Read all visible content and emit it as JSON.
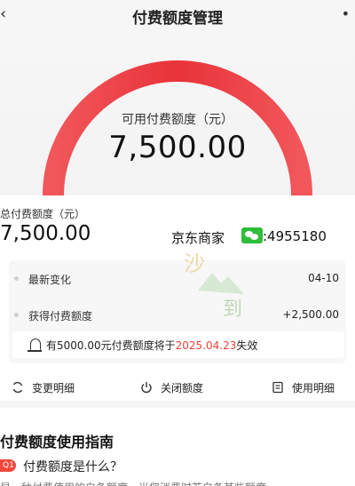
{
  "header": {
    "title": "付费额度管理",
    "back_icon": "chevron-left-icon",
    "more_icon": "more-icon"
  },
  "hero": {
    "available_label": "可用付费额度（元）",
    "available_amount": "7,500.00",
    "gauge_fill_fraction": 1.0,
    "gauge_color": "#f0473c"
  },
  "summary": {
    "total_label": "总付费额度（元）",
    "total_amount": "7,500.00",
    "watermark_text": "京东商家",
    "watermark_icon": "wechat-icon",
    "watermark_id": ":4955180"
  },
  "details": [
    {
      "label": "最新变化",
      "value": "04-10"
    },
    {
      "label": "获得付费额度",
      "value": "+2,500.00"
    }
  ],
  "notice": {
    "prefix": "有5000.00元付费额度将于",
    "date": "2025.04.23",
    "suffix": "失效",
    "icon": "bell-icon"
  },
  "actions": [
    {
      "label": "变更明细",
      "icon": "refresh-icon"
    },
    {
      "label": "关闭额度",
      "icon": "power-icon"
    },
    {
      "label": "使用明细",
      "icon": "document-icon"
    }
  ],
  "guide": {
    "title": "付费额度使用指南",
    "q_badge": "Q1",
    "question": "付费额度是什么？",
    "answer": "是一种付费使用的白条额度，当您消费时若白条某些额度"
  },
  "colors": {
    "accent": "#f0473c",
    "date_red": "#e8443a"
  }
}
